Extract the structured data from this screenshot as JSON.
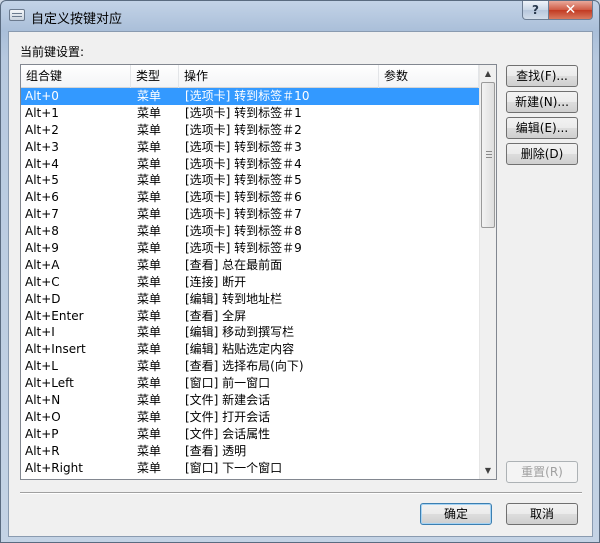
{
  "window": {
    "title": "自定义按键对应",
    "help_label": "?",
    "close_label": "✕"
  },
  "section_label": "当前键设置:",
  "columns": [
    "组合键",
    "类型",
    "操作",
    "参数"
  ],
  "rows": [
    {
      "key": "Alt+0",
      "type": "菜单",
      "action": "[选项卡] 转到标签＃10",
      "param": ""
    },
    {
      "key": "Alt+1",
      "type": "菜单",
      "action": "[选项卡] 转到标签＃1",
      "param": ""
    },
    {
      "key": "Alt+2",
      "type": "菜单",
      "action": "[选项卡] 转到标签＃2",
      "param": ""
    },
    {
      "key": "Alt+3",
      "type": "菜单",
      "action": "[选项卡] 转到标签＃3",
      "param": ""
    },
    {
      "key": "Alt+4",
      "type": "菜单",
      "action": "[选项卡] 转到标签＃4",
      "param": ""
    },
    {
      "key": "Alt+5",
      "type": "菜单",
      "action": "[选项卡] 转到标签＃5",
      "param": ""
    },
    {
      "key": "Alt+6",
      "type": "菜单",
      "action": "[选项卡] 转到标签＃6",
      "param": ""
    },
    {
      "key": "Alt+7",
      "type": "菜单",
      "action": "[选项卡] 转到标签＃7",
      "param": ""
    },
    {
      "key": "Alt+8",
      "type": "菜单",
      "action": "[选项卡] 转到标签＃8",
      "param": ""
    },
    {
      "key": "Alt+9",
      "type": "菜单",
      "action": "[选项卡] 转到标签＃9",
      "param": ""
    },
    {
      "key": "Alt+A",
      "type": "菜单",
      "action": "[查看] 总在最前面",
      "param": ""
    },
    {
      "key": "Alt+C",
      "type": "菜单",
      "action": "[连接] 断开",
      "param": ""
    },
    {
      "key": "Alt+D",
      "type": "菜单",
      "action": "[编辑] 转到地址栏",
      "param": ""
    },
    {
      "key": "Alt+Enter",
      "type": "菜单",
      "action": "[查看] 全屏",
      "param": ""
    },
    {
      "key": "Alt+I",
      "type": "菜单",
      "action": "[编辑] 移动到撰写栏",
      "param": ""
    },
    {
      "key": "Alt+Insert",
      "type": "菜单",
      "action": "[编辑] 粘贴选定内容",
      "param": ""
    },
    {
      "key": "Alt+L",
      "type": "菜单",
      "action": "[查看] 选择布局(向下)",
      "param": ""
    },
    {
      "key": "Alt+Left",
      "type": "菜单",
      "action": "[窗口] 前一窗口",
      "param": ""
    },
    {
      "key": "Alt+N",
      "type": "菜单",
      "action": "[文件] 新建会话",
      "param": ""
    },
    {
      "key": "Alt+O",
      "type": "菜单",
      "action": "[文件] 打开会话",
      "param": ""
    },
    {
      "key": "Alt+P",
      "type": "菜单",
      "action": "[文件] 会话属性",
      "param": ""
    },
    {
      "key": "Alt+R",
      "type": "菜单",
      "action": "[查看] 透明",
      "param": ""
    },
    {
      "key": "Alt+Right",
      "type": "菜单",
      "action": "[窗口] 下一个窗口",
      "param": ""
    }
  ],
  "selected_row": 0,
  "buttons": {
    "find": "查找(F)...",
    "new": "新建(N)...",
    "edit": "编辑(E)...",
    "delete": "删除(D)",
    "reset": "重置(R)",
    "ok": "确定",
    "cancel": "取消"
  },
  "colors": {
    "selection": "#3399ff",
    "client_bg": "#f0f0f0",
    "title_bar": "#aabfd9"
  },
  "icons": {
    "title": "keyboard-icon",
    "scroll_up": "chevron-up-icon",
    "scroll_down": "chevron-down-icon"
  }
}
